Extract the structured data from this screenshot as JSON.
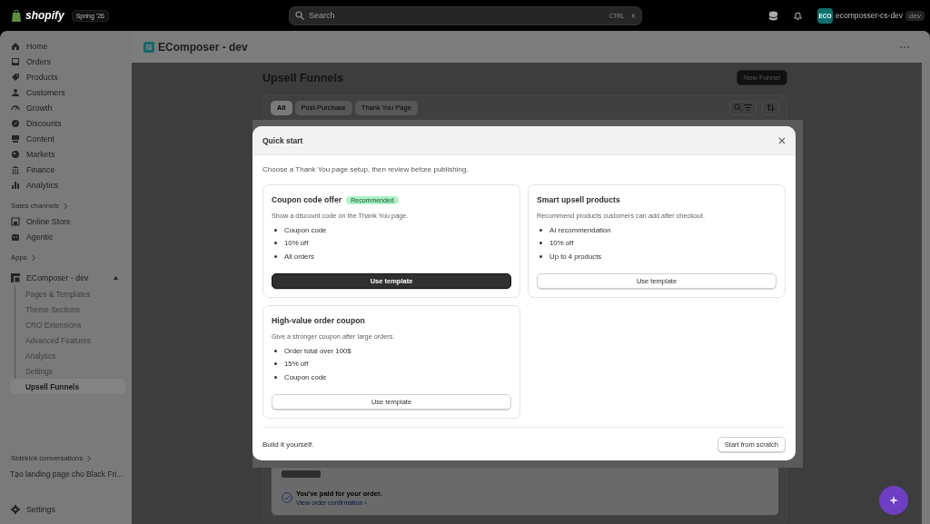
{
  "topbar": {
    "logo_text": "shopify",
    "edition": "Spring '26",
    "search": {
      "placeholder": "Search",
      "shortcut": [
        "CTRL",
        "K"
      ]
    },
    "store": {
      "initials": "ECO",
      "name": "ecomposser-cs-dev",
      "badge": "dev"
    }
  },
  "sidebar": {
    "main_items": [
      {
        "label": "Home",
        "selected": false
      },
      {
        "label": "Orders",
        "selected": false
      },
      {
        "label": "Products",
        "selected": false
      },
      {
        "label": "Customers",
        "selected": false
      },
      {
        "label": "Growth",
        "selected": false
      },
      {
        "label": "Discounts",
        "selected": false
      },
      {
        "label": "Content",
        "selected": false
      },
      {
        "label": "Markets",
        "selected": false
      },
      {
        "label": "Finance",
        "selected": false
      },
      {
        "label": "Analytics",
        "selected": false
      }
    ],
    "sales_channels": {
      "label": "Sales channels",
      "items": [
        {
          "label": "Online Store",
          "selected": false
        },
        {
          "label": "Agentic",
          "selected": false
        }
      ]
    },
    "apps": {
      "label": "Apps",
      "app": {
        "label": "EComposer - dev",
        "expanded": true,
        "children": [
          {
            "label": "Pages & Templates",
            "selected": false
          },
          {
            "label": "Theme Sections",
            "selected": false
          },
          {
            "label": "CRO Extensions",
            "selected": false
          },
          {
            "label": "Advanced Features",
            "selected": false
          },
          {
            "label": "Analytics",
            "selected": false
          },
          {
            "label": "Settings",
            "selected": false
          },
          {
            "label": "Upsell Funnels",
            "selected": true
          }
        ]
      }
    },
    "sidekick": {
      "label": "Sidekick conversations",
      "items": [
        "Tạo landing page cho Black Fri..."
      ]
    },
    "settings": {
      "label": "Settings"
    }
  },
  "app": {
    "title": "EComposer - dev",
    "page_title": "Upsell Funnels",
    "new_button": "New Funnel",
    "tabs": [
      {
        "label": "All",
        "selected": true
      },
      {
        "label": "Post-Purchase",
        "selected": false
      },
      {
        "label": "Thank You Page",
        "selected": false
      }
    ],
    "order_card": {
      "status": "You've paid for your order.",
      "link": "View order confirmation ›"
    }
  },
  "modal": {
    "title": "Quick start",
    "description": "Choose a Thank You page setup, then review before publishing.",
    "templates": [
      {
        "title": "Coupon code offer",
        "badge": "Recommended",
        "description": "Show a discount code on the Thank You page.",
        "features": [
          "Coupon code",
          "10% off",
          "All orders"
        ],
        "button": "Use template",
        "primary": true
      },
      {
        "title": "Smart upsell products",
        "description": "Recommend products customers can add after checkout.",
        "features": [
          "AI recommendation",
          "10% off",
          "Up to 4 products"
        ],
        "button": "Use template",
        "primary": false
      },
      {
        "title": "High-value order coupon",
        "description": "Give a stronger coupon after large orders.",
        "features": [
          "Order total over 100$",
          "15% off",
          "Coupon code"
        ],
        "button": "Use template",
        "primary": false
      }
    ],
    "footer_text": "Build it yourself.",
    "footer_button": "Start from scratch"
  }
}
